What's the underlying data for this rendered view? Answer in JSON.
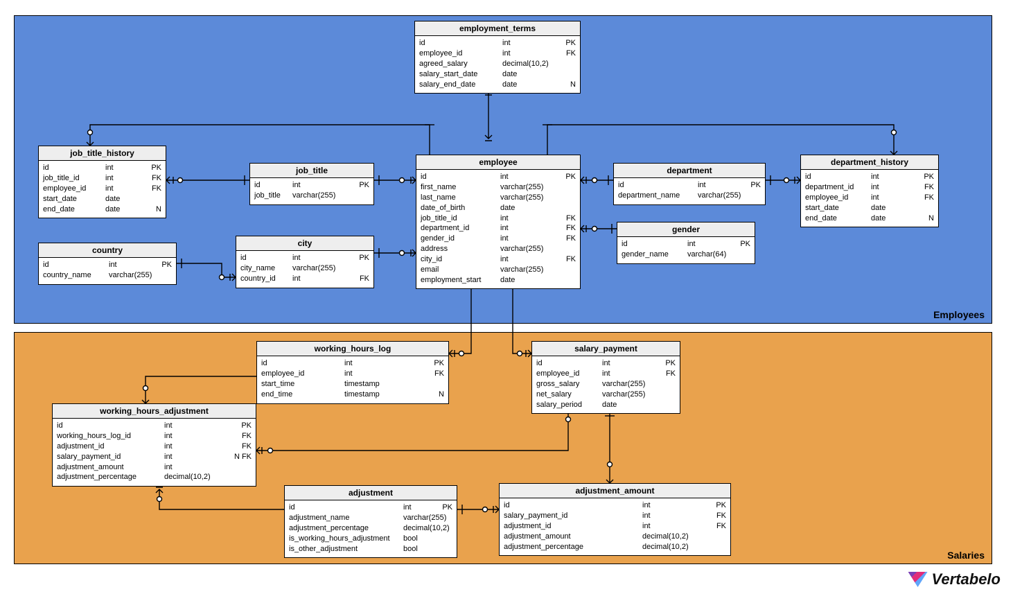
{
  "regions": {
    "employees": {
      "label": "Employees"
    },
    "salaries": {
      "label": "Salaries"
    }
  },
  "logo": {
    "text": "Vertabelo"
  },
  "tables": {
    "employment_terms": {
      "title": "employment_terms",
      "cols": [
        {
          "n": "id",
          "t": "int",
          "k": "PK"
        },
        {
          "n": "employee_id",
          "t": "int",
          "k": "FK"
        },
        {
          "n": "agreed_salary",
          "t": "decimal(10,2)",
          "k": ""
        },
        {
          "n": "salary_start_date",
          "t": "date",
          "k": ""
        },
        {
          "n": "salary_end_date",
          "t": "date",
          "k": "N"
        }
      ]
    },
    "job_title_history": {
      "title": "job_title_history",
      "cols": [
        {
          "n": "id",
          "t": "int",
          "k": "PK"
        },
        {
          "n": "job_title_id",
          "t": "int",
          "k": "FK"
        },
        {
          "n": "employee_id",
          "t": "int",
          "k": "FK"
        },
        {
          "n": "start_date",
          "t": "date",
          "k": ""
        },
        {
          "n": "end_date",
          "t": "date",
          "k": "N"
        }
      ]
    },
    "job_title": {
      "title": "job_title",
      "cols": [
        {
          "n": "id",
          "t": "int",
          "k": "PK"
        },
        {
          "n": "job_title",
          "t": "varchar(255)",
          "k": ""
        }
      ]
    },
    "employee": {
      "title": "employee",
      "cols": [
        {
          "n": "id",
          "t": "int",
          "k": "PK"
        },
        {
          "n": "first_name",
          "t": "varchar(255)",
          "k": ""
        },
        {
          "n": "last_name",
          "t": "varchar(255)",
          "k": ""
        },
        {
          "n": "date_of_birth",
          "t": "date",
          "k": ""
        },
        {
          "n": "job_title_id",
          "t": "int",
          "k": "FK"
        },
        {
          "n": "department_id",
          "t": "int",
          "k": "FK"
        },
        {
          "n": "gender_id",
          "t": "int",
          "k": "FK"
        },
        {
          "n": "address",
          "t": "varchar(255)",
          "k": ""
        },
        {
          "n": "city_id",
          "t": "int",
          "k": "FK"
        },
        {
          "n": "email",
          "t": "varchar(255)",
          "k": ""
        },
        {
          "n": "employment_start",
          "t": "date",
          "k": ""
        }
      ]
    },
    "department": {
      "title": "department",
      "cols": [
        {
          "n": "id",
          "t": "int",
          "k": "PK"
        },
        {
          "n": "department_name",
          "t": "varchar(255)",
          "k": ""
        }
      ]
    },
    "department_history": {
      "title": "department_history",
      "cols": [
        {
          "n": "id",
          "t": "int",
          "k": "PK"
        },
        {
          "n": "department_id",
          "t": "int",
          "k": "FK"
        },
        {
          "n": "employee_id",
          "t": "int",
          "k": "FK"
        },
        {
          "n": "start_date",
          "t": "date",
          "k": ""
        },
        {
          "n": "end_date",
          "t": "date",
          "k": "N"
        }
      ]
    },
    "country": {
      "title": "country",
      "cols": [
        {
          "n": "id",
          "t": "int",
          "k": "PK"
        },
        {
          "n": "country_name",
          "t": "varchar(255)",
          "k": ""
        }
      ]
    },
    "city": {
      "title": "city",
      "cols": [
        {
          "n": "id",
          "t": "int",
          "k": "PK"
        },
        {
          "n": "city_name",
          "t": "varchar(255)",
          "k": ""
        },
        {
          "n": "country_id",
          "t": "int",
          "k": "FK"
        }
      ]
    },
    "gender": {
      "title": "gender",
      "cols": [
        {
          "n": "id",
          "t": "int",
          "k": "PK"
        },
        {
          "n": "gender_name",
          "t": "varchar(64)",
          "k": ""
        }
      ]
    },
    "working_hours_log": {
      "title": "working_hours_log",
      "cols": [
        {
          "n": "id",
          "t": "int",
          "k": "PK"
        },
        {
          "n": "employee_id",
          "t": "int",
          "k": "FK"
        },
        {
          "n": "start_time",
          "t": "timestamp",
          "k": ""
        },
        {
          "n": "end_time",
          "t": "timestamp",
          "k": "N"
        }
      ]
    },
    "salary_payment": {
      "title": "salary_payment",
      "cols": [
        {
          "n": "id",
          "t": "int",
          "k": "PK"
        },
        {
          "n": "employee_id",
          "t": "int",
          "k": "FK"
        },
        {
          "n": "gross_salary",
          "t": "varchar(255)",
          "k": ""
        },
        {
          "n": "net_salary",
          "t": "varchar(255)",
          "k": ""
        },
        {
          "n": "salary_period",
          "t": "date",
          "k": ""
        }
      ]
    },
    "working_hours_adjustment": {
      "title": "working_hours_adjustment",
      "cols": [
        {
          "n": "id",
          "t": "int",
          "k": "PK"
        },
        {
          "n": "working_hours_log_id",
          "t": "int",
          "k": "FK"
        },
        {
          "n": "adjustment_id",
          "t": "int",
          "k": "FK"
        },
        {
          "n": "salary_payment_id",
          "t": "int",
          "k": "N FK"
        },
        {
          "n": "adjustment_amount",
          "t": "int",
          "k": ""
        },
        {
          "n": "adjustment_percentage",
          "t": "decimal(10,2)",
          "k": ""
        }
      ]
    },
    "adjustment": {
      "title": "adjustment",
      "cols": [
        {
          "n": "id",
          "t": "int",
          "k": "PK"
        },
        {
          "n": "adjustment_name",
          "t": "varchar(255)",
          "k": ""
        },
        {
          "n": "adjustment_percentage",
          "t": "decimal(10,2)",
          "k": ""
        },
        {
          "n": "is_working_hours_adjustment",
          "t": "bool",
          "k": ""
        },
        {
          "n": "is_other_adjustment",
          "t": "bool",
          "k": ""
        }
      ]
    },
    "adjustment_amount": {
      "title": "adjustment_amount",
      "cols": [
        {
          "n": "id",
          "t": "int",
          "k": "PK"
        },
        {
          "n": "salary_payment_id",
          "t": "int",
          "k": "FK"
        },
        {
          "n": "adjustment_id",
          "t": "int",
          "k": "FK"
        },
        {
          "n": "adjustment_amount",
          "t": "decimal(10,2)",
          "k": ""
        },
        {
          "n": "adjustment_percentage",
          "t": "decimal(10,2)",
          "k": ""
        }
      ]
    }
  }
}
